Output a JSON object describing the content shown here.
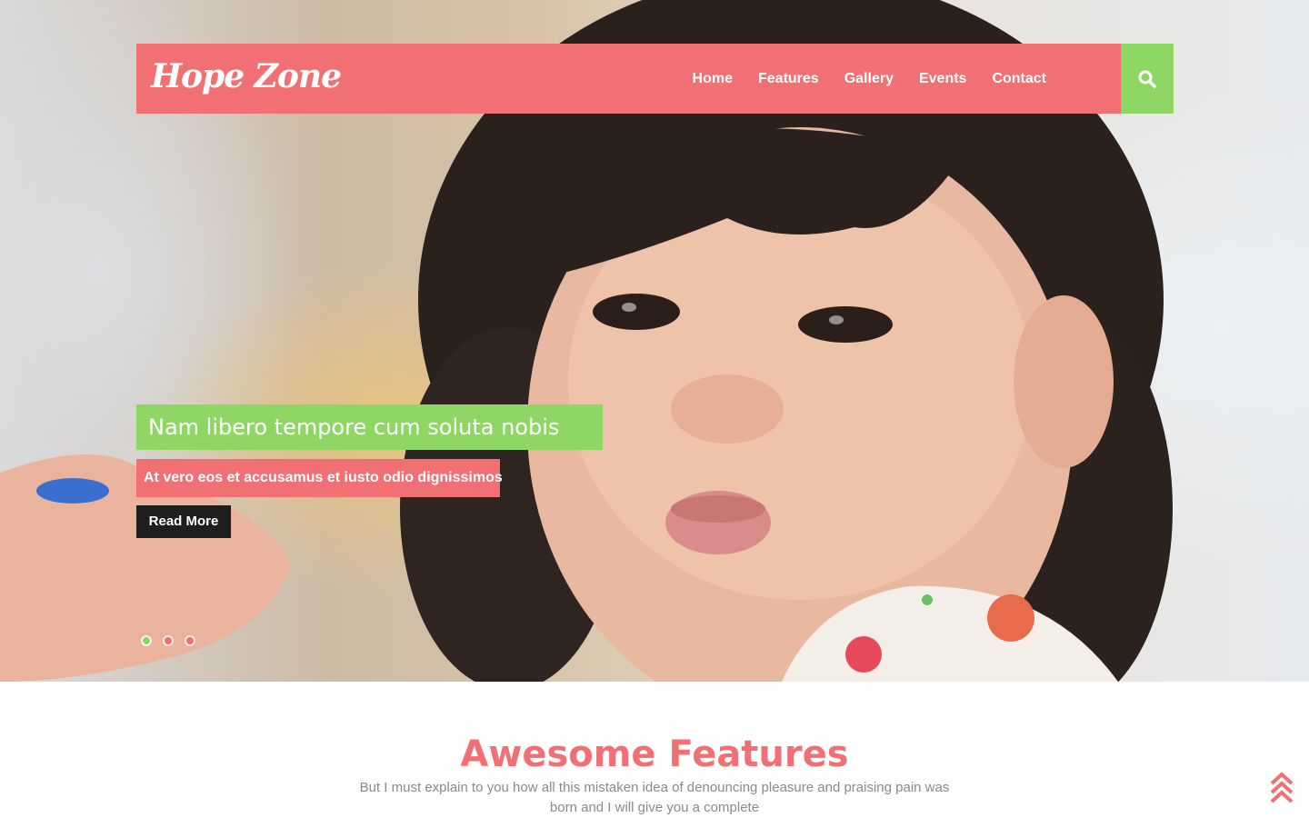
{
  "brand": {
    "logo_text": "Hope Zone"
  },
  "nav": {
    "items": [
      {
        "label": "Home"
      },
      {
        "label": "Features"
      },
      {
        "label": "Gallery"
      },
      {
        "label": "Events"
      },
      {
        "label": "Contact"
      }
    ],
    "search_icon": "search-icon"
  },
  "hero": {
    "title": "Nam libero tempore cum soluta nobis",
    "subtitle": "At vero eos et accusamus et iusto odio dignissimos",
    "button_label": "Read More",
    "slides": {
      "count": 3,
      "active_index": 0
    }
  },
  "features": {
    "heading": "Awesome Features",
    "description": "But I must explain to you how all this mistaken idea of denouncing pleasure and praising pain was born and I will give you a complete"
  },
  "scroll_top": {
    "icon": "double-chevron-up-icon"
  },
  "colors": {
    "primary_coral": "#f07073",
    "accent_green": "#8fd765",
    "dark_button": "#1e1e1e",
    "body_text_gray": "#8a8a8a",
    "white": "#ffffff"
  }
}
